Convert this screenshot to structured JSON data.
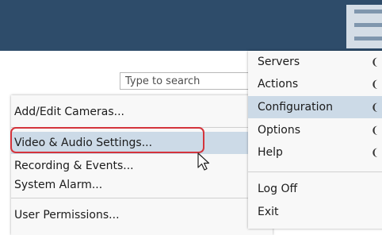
{
  "search": {
    "placeholder": "Type to search"
  },
  "left_menu": {
    "items": [
      {
        "label": "Add/Edit Cameras..."
      },
      {
        "label": "Video & Audio Settings..."
      },
      {
        "label": "Recording & Events..."
      },
      {
        "label": "System Alarm..."
      },
      {
        "label": "User Permissions..."
      }
    ]
  },
  "right_menu": {
    "items": [
      {
        "label": "Servers"
      },
      {
        "label": "Actions"
      },
      {
        "label": "Configuration"
      },
      {
        "label": "Options"
      },
      {
        "label": "Help"
      },
      {
        "label": "Log Off"
      },
      {
        "label": "Exit"
      }
    ]
  },
  "colors": {
    "header": "#2e4c6a",
    "highlight": "#ccdae7",
    "annotation": "#d4343c"
  },
  "icons": {
    "menu": "hamburger-icon",
    "pointer": "mouse-pointer-icon",
    "submenu": "submenu-indicator-icon"
  }
}
